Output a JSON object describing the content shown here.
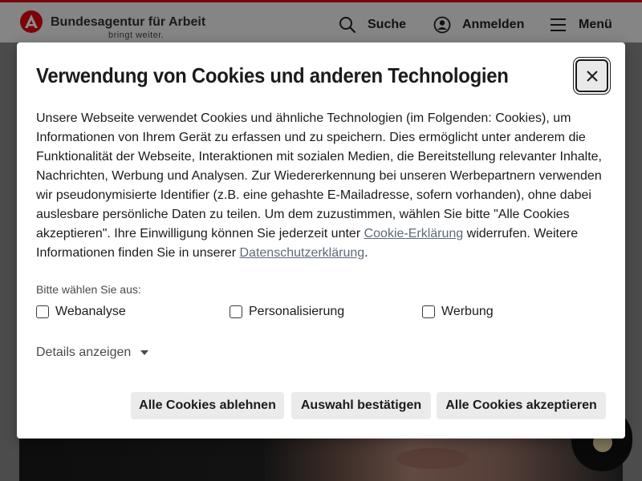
{
  "header": {
    "brand_name": "Bundesagentur für Arbeit",
    "brand_tagline": "bringt weiter.",
    "search_label": "Suche",
    "login_label": "Anmelden",
    "menu_label": "Menü",
    "brand_color": "#e20613"
  },
  "dialog": {
    "title": "Verwendung von Cookies und anderen Technologien",
    "close_icon": "close-icon",
    "text_main": "Unsere Webseite verwendet Cookies und ähnliche Technologien (im Folgenden: Cookies), um Informationen von Ihrem Gerät zu erfassen und zu speichern. Dies ermöglicht unter anderem die Funktionalität der Webseite, Interaktionen mit sozialen Medien, die Bereitstellung relevanter Inhalte, Nachrichten, Werbung und Analysen. Zur Wiedererkennung bei unseren Werbepartnern verwenden wir pseudonymisierte Identifier (z.B. eine gehashte E-Mailadresse, sofern vorhanden), ohne dabei auslesbare persönliche Daten zu teilen. Um dem zuzustimmen, wählen Sie bitte \"Alle Cookies akzeptieren\". Ihre Einwilligung können Sie jederzeit unter",
    "link_cookie": "Cookie-Erklärung",
    "text_mid": "widerrufen. Weitere Informationen finden Sie in unserer",
    "link_privacy": "Datenschutzerklärung",
    "text_end": ".",
    "choose_label": "Bitte wählen Sie aus:",
    "options": [
      "Webanalyse",
      "Personalisierung",
      "Werbung"
    ],
    "details_label": "Details anzeigen",
    "buttons": {
      "reject": "Alle Cookies ablehnen",
      "confirm": "Auswahl bestätigen",
      "accept": "Alle Cookies akzeptieren"
    }
  }
}
